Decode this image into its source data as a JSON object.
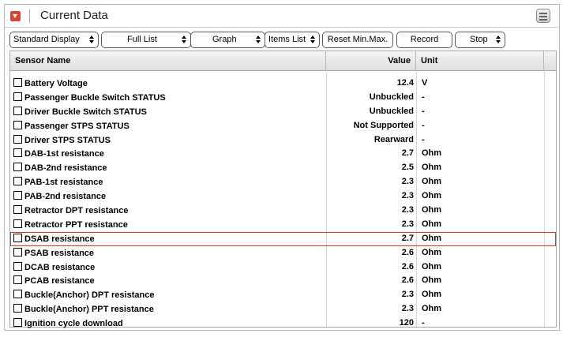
{
  "window": {
    "title": "Current Data"
  },
  "toolbar": {
    "standard_display": "Standard Display",
    "full_list": "Full List",
    "graph": "Graph",
    "items_list": "Items List",
    "reset_min_max": "Reset Min.Max.",
    "record": "Record",
    "stop": "Stop"
  },
  "table": {
    "headers": {
      "sensor_name": "Sensor Name",
      "value": "Value",
      "unit": "Unit"
    },
    "rows": [
      {
        "name": "Battery Voltage",
        "value": "12.4",
        "unit": "V"
      },
      {
        "name": "Passenger Buckle Switch STATUS",
        "value": "Unbuckled",
        "unit": "-"
      },
      {
        "name": "Driver Buckle Switch STATUS",
        "value": "Unbuckled",
        "unit": "-"
      },
      {
        "name": "Passenger STPS STATUS",
        "value": "Not Supported",
        "unit": "-"
      },
      {
        "name": "Driver STPS STATUS",
        "value": "Rearward",
        "unit": "-"
      },
      {
        "name": "DAB-1st resistance",
        "value": "2.7",
        "unit": "Ohm"
      },
      {
        "name": "DAB-2nd resistance",
        "value": "2.5",
        "unit": "Ohm"
      },
      {
        "name": "PAB-1st resistance",
        "value": "2.3",
        "unit": "Ohm"
      },
      {
        "name": "PAB-2nd resistance",
        "value": "2.3",
        "unit": "Ohm"
      },
      {
        "name": "Retractor DPT resistance",
        "value": "2.3",
        "unit": "Ohm"
      },
      {
        "name": "Retractor PPT resistance",
        "value": "2.3",
        "unit": "Ohm"
      },
      {
        "name": "DSAB resistance",
        "value": "2.7",
        "unit": "Ohm"
      },
      {
        "name": "PSAB resistance",
        "value": "2.6",
        "unit": "Ohm"
      },
      {
        "name": "DCAB resistance",
        "value": "2.6",
        "unit": "Ohm"
      },
      {
        "name": "PCAB resistance",
        "value": "2.6",
        "unit": "Ohm"
      },
      {
        "name": "Buckle(Anchor) DPT resistance",
        "value": "2.3",
        "unit": "Ohm"
      },
      {
        "name": "Buckle(Anchor) PPT resistance",
        "value": "2.3",
        "unit": "Ohm"
      },
      {
        "name": "Ignition cycle download",
        "value": "120",
        "unit": "-"
      }
    ]
  },
  "colors": {
    "accent": "#e0442f",
    "selection_outline": "#d9302c"
  },
  "icons": {
    "title": "collapse-arrow-icon",
    "menu": "menu-list-icon"
  }
}
